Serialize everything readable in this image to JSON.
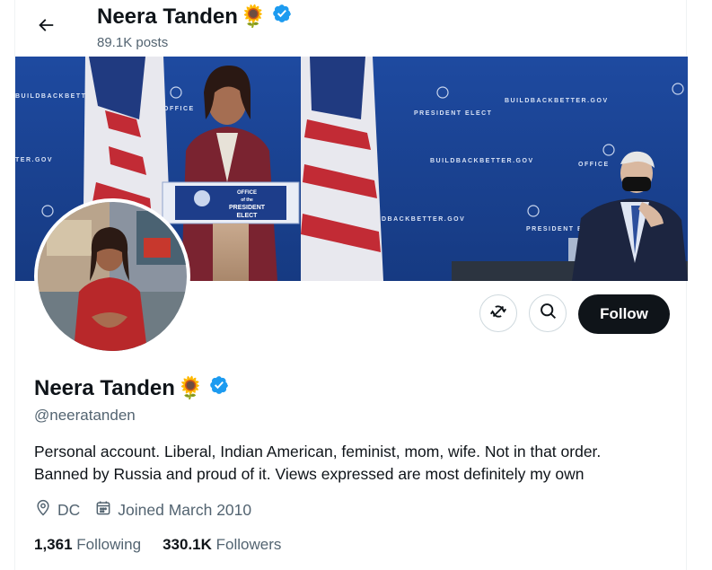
{
  "header": {
    "back_icon": "arrow-left-icon",
    "name": "Neera Tanden",
    "name_emoji": "🌻",
    "posts_count": "89.1K posts"
  },
  "banner": {
    "sign_main": "OFFICE of the PRESIDENT ELECT",
    "sign_office": "OFFICE",
    "sign_of_the": "of the",
    "sign_president": "PRESIDENT",
    "sign_elect": "ELECT",
    "backdrop_text_1": "BUILDBACKBETT",
    "backdrop_text_2": "BUILDBACKBETTER.GOV",
    "backdrop_text_3": "TER.GOV",
    "backdrop_text_4": "BUILDBACKBETTER.GOV",
    "backdrop_text_5": "DBACKBETTER.GOV",
    "backdrop_office_1": "OFFICE",
    "backdrop_office_2": "PRESIDENT ELECT"
  },
  "actions": {
    "more_icon": "notifications-off-icon",
    "search_icon": "search-icon",
    "follow_label": "Follow"
  },
  "profile": {
    "name": "Neera Tanden",
    "name_emoji": "🌻",
    "handle": "@neeratanden",
    "bio_line_1": "Personal account. Liberal, Indian American, feminist, mom, wife. Not in that order.",
    "bio_line_2": "Banned by Russia and proud of it. Views expressed are most definitely my own",
    "location": "DC",
    "joined": "Joined March 2010",
    "following_count": "1,361",
    "following_label": "Following",
    "followers_count": "330.1K",
    "followers_label": "Followers"
  },
  "colors": {
    "verified": "#1d9bf0",
    "follow_bg": "#0f1419",
    "secondary_text": "#536471",
    "banner_blue": "#1b3f8e"
  }
}
